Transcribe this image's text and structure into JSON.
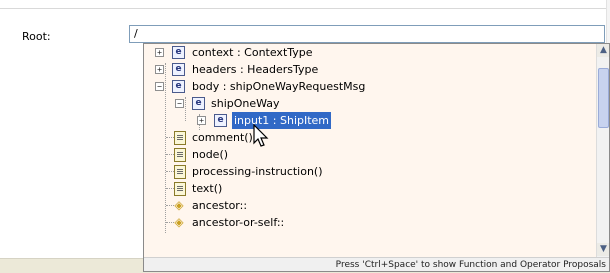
{
  "form": {
    "root_label": "Root:",
    "root_value": "/"
  },
  "popup": {
    "items": [
      {
        "label": "context : ContextType",
        "icon": "element-icon",
        "icon_text": "e",
        "expander": "+"
      },
      {
        "label": "headers : HeadersType",
        "icon": "element-icon",
        "icon_text": "e",
        "expander": "+"
      },
      {
        "label": "body : shipOneWayRequestMsg",
        "icon": "element-icon",
        "icon_text": "e",
        "expander": "−"
      },
      {
        "label": "shipOneWay",
        "icon": "element-icon",
        "icon_text": "e",
        "expander": "−"
      },
      {
        "label": "input1 : ShipItem",
        "icon": "element-icon",
        "icon_text": "e",
        "expander": "+",
        "selected": true
      },
      {
        "label": "comment()",
        "icon": "document-icon"
      },
      {
        "label": "node()",
        "icon": "document-icon"
      },
      {
        "label": "processing-instruction()",
        "icon": "document-icon"
      },
      {
        "label": "text()",
        "icon": "document-icon"
      },
      {
        "label": "ancestor::",
        "icon": "axis-icon",
        "icon_text": "◈"
      },
      {
        "label": "ancestor-or-self::",
        "icon": "axis-icon",
        "icon_text": "◈"
      }
    ],
    "status": "Press 'Ctrl+Space' to show Function and Operator Proposals",
    "scroll_up": "▲",
    "scroll_down": "▼"
  },
  "colors": {
    "popup_background": "#fff6ee",
    "selection": "#3169c6"
  }
}
